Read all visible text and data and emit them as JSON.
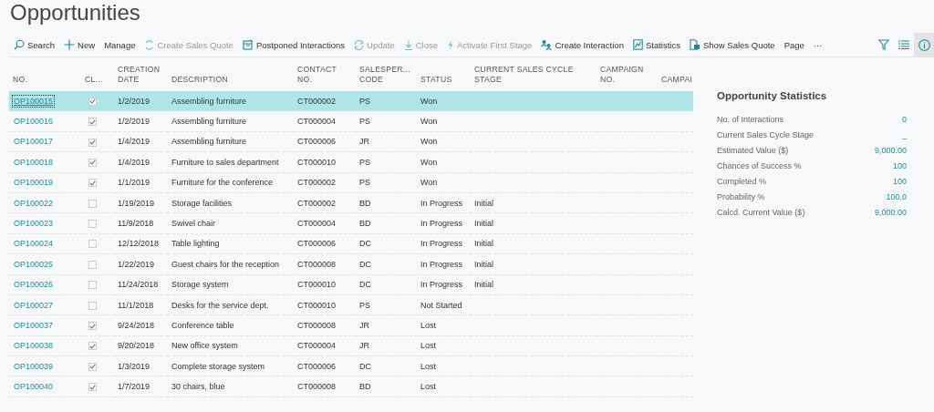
{
  "page": {
    "title": "Opportunities"
  },
  "toolbar": {
    "actions": [
      {
        "label": "Search",
        "kind": "search",
        "disabled": false
      },
      {
        "label": "New",
        "kind": "plus",
        "disabled": false
      },
      {
        "label": "Manage",
        "kind": "none",
        "disabled": false
      },
      {
        "label": "Create Sales Quote",
        "kind": "quote",
        "disabled": true
      },
      {
        "label": "Postponed Interactions",
        "kind": "calendar",
        "disabled": false
      },
      {
        "label": "Update",
        "kind": "refresh",
        "disabled": true
      },
      {
        "label": "Close",
        "kind": "download",
        "disabled": true
      },
      {
        "label": "Activate First Stage",
        "kind": "bolt",
        "disabled": true
      },
      {
        "label": "Create Interaction",
        "kind": "people",
        "disabled": false
      },
      {
        "label": "Statistics",
        "kind": "chart",
        "disabled": false
      },
      {
        "label": "Show Sales Quote",
        "kind": "document",
        "disabled": false
      },
      {
        "label": "Page",
        "kind": "none",
        "disabled": false
      },
      {
        "label": "···",
        "kind": "none",
        "disabled": false
      }
    ],
    "tools": [
      {
        "kind": "filter",
        "selected": false
      },
      {
        "kind": "list",
        "selected": false
      },
      {
        "kind": "info",
        "selected": true
      }
    ]
  },
  "table": {
    "columns": [
      [
        "NO."
      ],
      [
        "CL..."
      ],
      [
        "CREATION",
        "DATE"
      ],
      [
        "DESCRIPTION"
      ],
      [
        "CONTACT",
        "NO."
      ],
      [
        "SALESPER...",
        "CODE"
      ],
      [
        "STATUS"
      ],
      [
        "CURRENT SALES CYCLE",
        "STAGE"
      ],
      [
        "CAMPAIGN",
        "NO."
      ],
      [
        "CAMPAI"
      ]
    ],
    "rows": [
      {
        "no": "OP100015",
        "closed": true,
        "date": "1/2/2019",
        "description": "Assembling furniture",
        "contact": "CT000002",
        "salesperson": "PS",
        "status": "Won",
        "stage": "",
        "selected": true
      },
      {
        "no": "OP100016",
        "closed": true,
        "date": "1/2/2019",
        "description": "Assembling furniture",
        "contact": "CT000004",
        "salesperson": "PS",
        "status": "Won",
        "stage": "",
        "selected": false
      },
      {
        "no": "OP100017",
        "closed": true,
        "date": "1/4/2019",
        "description": "Assembling furniture",
        "contact": "CT000006",
        "salesperson": "JR",
        "status": "Won",
        "stage": "",
        "selected": false
      },
      {
        "no": "OP100018",
        "closed": true,
        "date": "1/4/2019",
        "description": "Furniture to sales department",
        "contact": "CT000010",
        "salesperson": "PS",
        "status": "Won",
        "stage": "",
        "selected": false
      },
      {
        "no": "OP100019",
        "closed": true,
        "date": "1/1/2019",
        "description": "Furniture for the conference",
        "contact": "CT000002",
        "salesperson": "PS",
        "status": "Won",
        "stage": "",
        "selected": false
      },
      {
        "no": "OP100022",
        "closed": false,
        "date": "1/19/2019",
        "description": "Storage facilities",
        "contact": "CT000002",
        "salesperson": "BD",
        "status": "In Progress",
        "stage": "Initial",
        "selected": false
      },
      {
        "no": "OP100023",
        "closed": false,
        "date": "11/9/2018",
        "description": "Swivel chair",
        "contact": "CT000004",
        "salesperson": "BD",
        "status": "In Progress",
        "stage": "Initial",
        "selected": false
      },
      {
        "no": "OP100024",
        "closed": false,
        "date": "12/12/2018",
        "description": "Table lighting",
        "contact": "CT000006",
        "salesperson": "DC",
        "status": "In Progress",
        "stage": "Initial",
        "selected": false
      },
      {
        "no": "OP100025",
        "closed": false,
        "date": "1/22/2019",
        "description": "Guest chairs for the reception",
        "contact": "CT000008",
        "salesperson": "DC",
        "status": "In Progress",
        "stage": "Initial",
        "selected": false
      },
      {
        "no": "OP100026",
        "closed": false,
        "date": "11/24/2018",
        "description": "Storage system",
        "contact": "CT000010",
        "salesperson": "DC",
        "status": "In Progress",
        "stage": "Initial",
        "selected": false
      },
      {
        "no": "OP100027",
        "closed": false,
        "date": "11/1/2018",
        "description": "Desks for the service dept.",
        "contact": "CT000010",
        "salesperson": "PS",
        "status": "Not Started",
        "stage": "",
        "selected": false
      },
      {
        "no": "OP100037",
        "closed": true,
        "date": "9/24/2018",
        "description": "Conference table",
        "contact": "CT000008",
        "salesperson": "JR",
        "status": "Lost",
        "stage": "",
        "selected": false
      },
      {
        "no": "OP100038",
        "closed": true,
        "date": "9/20/2018",
        "description": "New office system",
        "contact": "CT000004",
        "salesperson": "JR",
        "status": "Lost",
        "stage": "",
        "selected": false
      },
      {
        "no": "OP100039",
        "closed": true,
        "date": "1/3/2019",
        "description": "Complete storage system",
        "contact": "CT000006",
        "salesperson": "DC",
        "status": "Lost",
        "stage": "",
        "selected": false
      },
      {
        "no": "OP100040",
        "closed": true,
        "date": "1/7/2019",
        "description": "30 chairs, blue",
        "contact": "CT000008",
        "salesperson": "BD",
        "status": "Lost",
        "stage": "",
        "selected": false
      }
    ]
  },
  "factbox": {
    "title": "Opportunity Statistics",
    "fields": [
      {
        "label": "No. of Interactions",
        "value": "0"
      },
      {
        "label": "Current Sales Cycle Stage",
        "value": "_"
      },
      {
        "label": "Estimated Value ($)",
        "value": "9,000.00"
      },
      {
        "label": "Chances of Success %",
        "value": "100"
      },
      {
        "label": "Completed %",
        "value": "100"
      },
      {
        "label": "Probability %",
        "value": "100.0"
      },
      {
        "label": "Calcd. Current Value ($)",
        "value": "9,000.00"
      }
    ]
  }
}
